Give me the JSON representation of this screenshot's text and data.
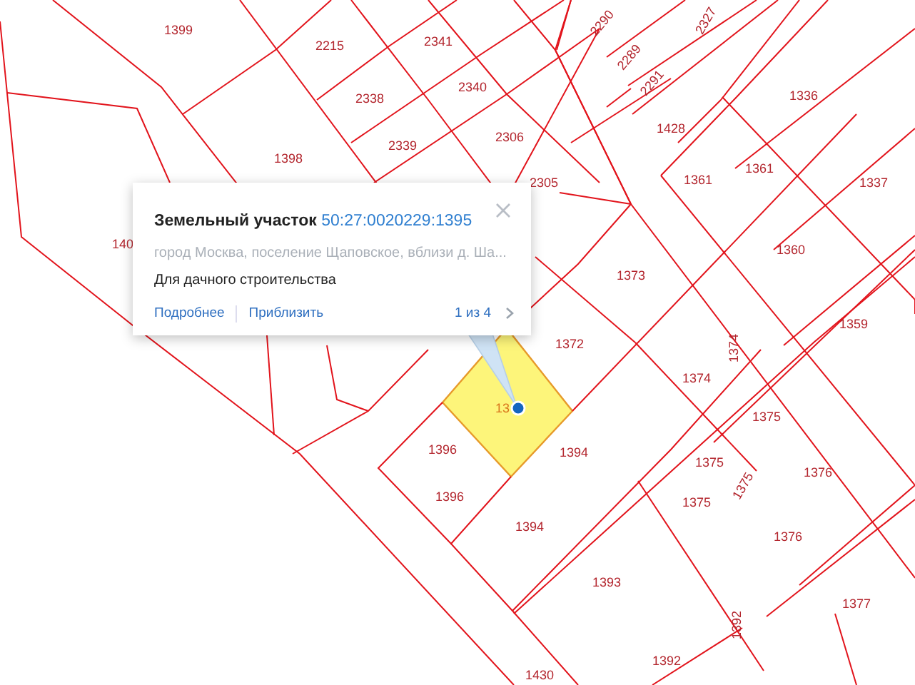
{
  "map": {
    "parcels": [
      {
        "label": "1399",
        "selected": false
      },
      {
        "label": "2215",
        "selected": false
      },
      {
        "label": "2341",
        "selected": false
      },
      {
        "label": "2290",
        "selected": false
      },
      {
        "label": "2327",
        "selected": false
      },
      {
        "label": "2289",
        "selected": false
      },
      {
        "label": "2291",
        "selected": false
      },
      {
        "label": "2338",
        "selected": false
      },
      {
        "label": "2340",
        "selected": false
      },
      {
        "label": "1336",
        "selected": false
      },
      {
        "label": "1428",
        "selected": false
      },
      {
        "label": "2339",
        "selected": false
      },
      {
        "label": "2306",
        "selected": false
      },
      {
        "label": "1398",
        "selected": false
      },
      {
        "label": "2305",
        "selected": false
      },
      {
        "label": "1361",
        "selected": false
      },
      {
        "label": "1361",
        "selected": false
      },
      {
        "label": "1337",
        "selected": false
      },
      {
        "label": "140",
        "selected": false
      },
      {
        "label": "1360",
        "selected": false
      },
      {
        "label": "1373",
        "selected": false
      },
      {
        "label": "1359",
        "selected": false
      },
      {
        "label": "1372",
        "selected": false
      },
      {
        "label": "1374",
        "selected": false
      },
      {
        "label": "1374",
        "selected": false
      },
      {
        "label": "13",
        "selected": true
      },
      {
        "label": "1375",
        "selected": false
      },
      {
        "label": "1396",
        "selected": false
      },
      {
        "label": "1394",
        "selected": false
      },
      {
        "label": "1375",
        "selected": false
      },
      {
        "label": "1376",
        "selected": false
      },
      {
        "label": "1375",
        "selected": false
      },
      {
        "label": "1396",
        "selected": false
      },
      {
        "label": "1375",
        "selected": false
      },
      {
        "label": "1394",
        "selected": false
      },
      {
        "label": "1376",
        "selected": false
      },
      {
        "label": "1393",
        "selected": false
      },
      {
        "label": "1377",
        "selected": false
      },
      {
        "label": "1392",
        "selected": false
      },
      {
        "label": "1392",
        "selected": false
      },
      {
        "label": "1430",
        "selected": false
      }
    ]
  },
  "popup": {
    "title": "Земельный участок",
    "cadastral_number": "50:27:0020229:1395",
    "address": "город Москва, поселение Щаповское, вблизи д. Ша...",
    "purpose": "Для дачного строительства",
    "links": [
      "Подробнее",
      "Приблизить"
    ],
    "pager": "1 из 4"
  }
}
